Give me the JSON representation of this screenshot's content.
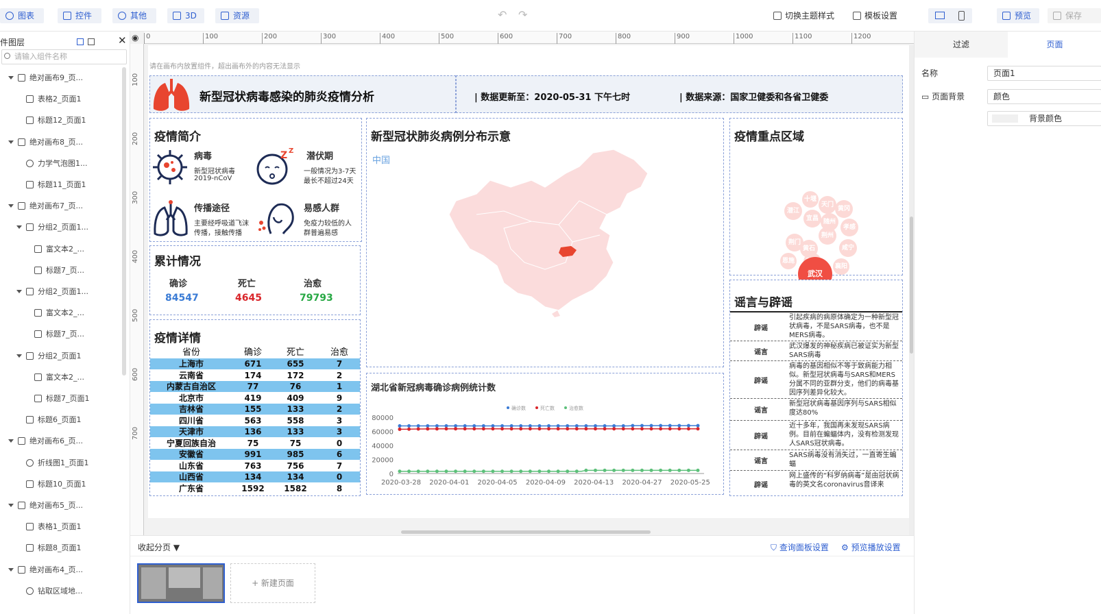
{
  "toolbar": {
    "buttons": [
      "图表",
      "控件",
      "其他",
      "3D",
      "资源"
    ],
    "switch_theme": "切换主题样式",
    "template_settings": "模板设置",
    "preview": "预览",
    "save": "保存"
  },
  "layers": {
    "title": "组件图层",
    "search_placeholder": "请输入组件名称",
    "items": [
      {
        "label": "绝对画布9_页..."
      },
      {
        "label": "表格2_页面1"
      },
      {
        "label": "标题12_页面1"
      },
      {
        "label": "绝对画布8_页..."
      },
      {
        "label": "力学气泡图1..."
      },
      {
        "label": "标题11_页面1"
      },
      {
        "label": "绝对画布7_页..."
      },
      {
        "label": "分组2_页面1..."
      },
      {
        "label": "富文本2_..."
      },
      {
        "label": "标题7_页..."
      },
      {
        "label": "分组2_页面1..."
      },
      {
        "label": "富文本2_..."
      },
      {
        "label": "标题7_页..."
      },
      {
        "label": "分组2_页面1"
      },
      {
        "label": "富文本2_..."
      },
      {
        "label": "标题7_页面1"
      },
      {
        "label": "标题6_页面1"
      },
      {
        "label": "绝对画布6_页..."
      },
      {
        "label": "折线图1_页面1"
      },
      {
        "label": "标题10_页面1"
      },
      {
        "label": "绝对画布5_页..."
      },
      {
        "label": "表格1_页面1"
      },
      {
        "label": "标题8_页面1"
      },
      {
        "label": "绝对画布4_页..."
      },
      {
        "label": "钻取区域地..."
      }
    ]
  },
  "ruler": {
    "h": [
      "0",
      "100",
      "200",
      "300",
      "400",
      "500",
      "600",
      "700",
      "800",
      "900",
      "1000",
      "1100",
      "1200"
    ],
    "v": [
      "100",
      "200",
      "300",
      "400",
      "500",
      "600",
      "700"
    ]
  },
  "canvas": {
    "hint": "请在画布内放置组件，超出画布外的内容无法显示",
    "header_title": "新型冠状病毒感染的肺炎疫情分析",
    "update_text": "| 数据更新至：2020-05-31 下午七时",
    "source_text": "| 数据来源：国家卫健委和各省卫健委",
    "intro_title": "疫情简介",
    "intro": [
      {
        "title": "病毒",
        "line1": "新型冠状病毒",
        "line2": "2019-nCoV"
      },
      {
        "title": "潜伏期",
        "line1": "一般情况为3-7天",
        "line2": "最长不超过24天"
      },
      {
        "title": "传播途径",
        "line1": "主要经呼吸道飞沫",
        "line2": "传播，接触传播"
      },
      {
        "title": "易感人群",
        "line1": "免疫力较低的人",
        "line2": "群普遍易感"
      }
    ],
    "total_title": "累计情况",
    "totals": [
      {
        "label": "确诊",
        "value": "84547",
        "color": "#3a7bd5"
      },
      {
        "label": "死亡",
        "value": "4645",
        "color": "#d9252a"
      },
      {
        "label": "治愈",
        "value": "79793",
        "color": "#27a844"
      }
    ],
    "detail_title": "疫情详情",
    "table_headers": [
      "省份",
      "确诊",
      "死亡",
      "治愈"
    ],
    "table_rows": [
      [
        "上海市",
        "671",
        "655",
        "7"
      ],
      [
        "云南省",
        "174",
        "172",
        "2"
      ],
      [
        "内蒙古自治区",
        "77",
        "76",
        "1"
      ],
      [
        "北京市",
        "419",
        "409",
        "9"
      ],
      [
        "吉林省",
        "155",
        "133",
        "2"
      ],
      [
        "四川省",
        "563",
        "558",
        "3"
      ],
      [
        "天津市",
        "136",
        "133",
        "3"
      ],
      [
        "宁夏回族自治区",
        "75",
        "75",
        "0"
      ],
      [
        "安徽省",
        "991",
        "985",
        "6"
      ],
      [
        "山东省",
        "763",
        "756",
        "7"
      ],
      [
        "山西省",
        "134",
        "134",
        "0"
      ],
      [
        "广东省",
        "1592",
        "1582",
        "8"
      ]
    ],
    "map_title": "新型冠状肺炎病例分布示意",
    "map_label": "中国",
    "bubble_title": "疫情重点区域",
    "bubbles": [
      {
        "label": "十堰"
      },
      {
        "label": "天门"
      },
      {
        "label": "黄冈"
      },
      {
        "label": "潜江"
      },
      {
        "label": "宜昌"
      },
      {
        "label": "随州"
      },
      {
        "label": "孝感"
      },
      {
        "label": "荆门"
      },
      {
        "label": "黄石"
      },
      {
        "label": "荆州"
      },
      {
        "label": "咸宁"
      },
      {
        "label": "恩施"
      },
      {
        "label": "鄂州"
      },
      {
        "label": "襄阳"
      },
      {
        "label": "武汉"
      }
    ],
    "rumor_title": "谣言与辟谣",
    "rumors": [
      {
        "tag": "辟谣",
        "text": "引起疾病的病原体确定为一种新型冠状病毒，不是SARS病毒，也不是MERS病毒。"
      },
      {
        "tag": "谣言",
        "text": "武汉爆发的神秘疾病已被证实为新型SARS病毒"
      },
      {
        "tag": "辟谣",
        "text": "病毒的基因相似不等于致病能力相似。新型冠状病毒与SARS和MERS分属不同的亚群分支，他们的病毒基因序列差异化较大。"
      },
      {
        "tag": "谣言",
        "text": "新型冠状病毒基因序列与SARS相似度达80%"
      },
      {
        "tag": "辟谣",
        "text": "近十多年，我国再未发现SARS病例。目前在蝙蝠体内，没有检测发现人SARS冠状病毒。"
      },
      {
        "tag": "谣言",
        "text": "SARS病毒没有消失过，一直寄生蝙蝠"
      },
      {
        "tag": "辟谣",
        "text": "网上盛传的“科罗纳病毒”是由冠状病毒的英文名coronavirus音译来"
      }
    ]
  },
  "chart_data": {
    "type": "line",
    "title": "湖北省新冠病毒确诊病例统计数",
    "x_ticks": [
      "2020-03-28",
      "2020-04-01",
      "2020-04-05",
      "2020-04-09",
      "2020-04-13",
      "2020-04-27",
      "2020-05-25"
    ],
    "y_ticks": [
      "0",
      "20000",
      "40000",
      "60000",
      "80000"
    ],
    "ylim": [
      0,
      80000
    ],
    "series": [
      {
        "name": "确诊数",
        "color": "#3a7bd5",
        "values": [
          67801,
          67801,
          67802,
          67803,
          67803,
          67803,
          67803,
          67803,
          67803,
          67803,
          67803,
          67803,
          67803,
          67803,
          67803,
          67803,
          67803,
          67803,
          67803,
          67803,
          67803,
          67803,
          67803,
          67803,
          67803,
          67803,
          67803,
          67803,
          67803,
          67803,
          67803,
          67803,
          67803,
          67803,
          67803,
          67803,
          67803,
          67803,
          67803,
          67803,
          67803,
          67803,
          67803,
          67803,
          67803,
          67803,
          67803,
          67803,
          67803,
          67803,
          68128,
          68128,
          68128,
          68128,
          68128,
          68128,
          68128,
          68128,
          68128,
          68128,
          68128,
          68128,
          68128,
          68128,
          68128
        ]
      },
      {
        "name": "死亡数",
        "color": "#d9252a",
        "values": [
          63000,
          63100,
          63200,
          63300,
          63400,
          63450,
          63500,
          63550,
          63600,
          63650,
          63700,
          63700,
          63700,
          63700,
          63700,
          63700,
          63700,
          63700,
          63700,
          63700,
          63700,
          63700,
          63700,
          63700,
          63700,
          63700,
          63700,
          63700,
          63700,
          63700,
          63700,
          63700,
          63700,
          63700,
          63700,
          63700,
          63700,
          63700,
          63700,
          63700,
          63700,
          63700,
          63700,
          63700,
          63700,
          63700,
          63700,
          63700,
          63700,
          63700,
          63700,
          63700,
          63700,
          63700,
          63700,
          63700,
          63700,
          63700,
          63700,
          63700,
          63700,
          63700,
          63700,
          63700,
          63700
        ]
      },
      {
        "name": "治愈数",
        "color": "#5cc07a",
        "values": [
          3174,
          3177,
          3182,
          3186,
          3187,
          3193,
          3199,
          3203,
          3207,
          3210,
          3212,
          3212,
          3213,
          3213,
          3213,
          3213,
          3213,
          3213,
          3213,
          3213,
          3213,
          3213,
          3213,
          3213,
          3213,
          3213,
          3213,
          3213,
          3213,
          3213,
          3213,
          3213,
          3213,
          3213,
          3213,
          3213,
          3213,
          3213,
          3213,
          3213,
          4512,
          4512,
          4512,
          4512,
          4512,
          4512,
          4512,
          4512,
          4512,
          4512,
          4512,
          4512,
          4512,
          4512,
          4512,
          4512,
          4512,
          4512,
          4512,
          4512,
          4512,
          4512,
          4512,
          4512,
          4512
        ]
      }
    ]
  },
  "bottom": {
    "collapse": "收起分页",
    "query_settings": "查询面板设置",
    "play_settings": "预览播放设置",
    "new_page": "+ 新建页面"
  },
  "right": {
    "tab_filter": "过滤",
    "tab_page": "页面",
    "name_label": "名称",
    "name_value": "页面1",
    "bg_label": "页面背景",
    "bg_value": "颜色",
    "bg_color_label": "背景颜色"
  }
}
